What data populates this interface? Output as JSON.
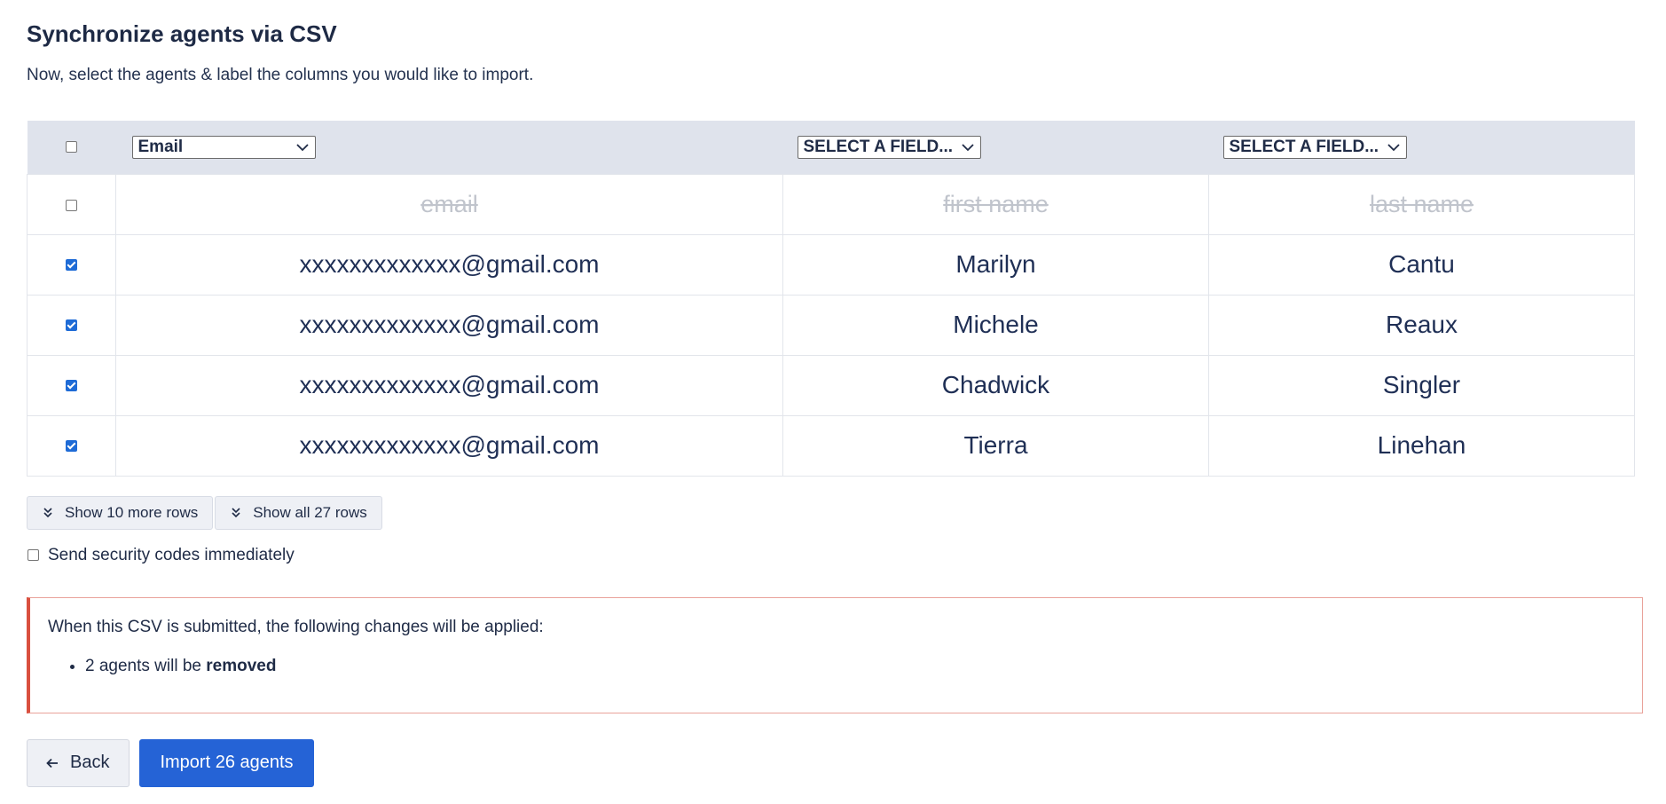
{
  "page": {
    "title": "Synchronize agents via CSV",
    "subtitle": "Now, select the agents & label the columns you would like to import."
  },
  "table": {
    "select_all_checked": false,
    "column_selects": [
      {
        "value": "Email",
        "icon": "chevron-down-icon"
      },
      {
        "value": "SELECT A FIELD...",
        "icon": "chevron-down-icon"
      },
      {
        "value": "SELECT A FIELD...",
        "icon": "chevron-down-icon"
      }
    ],
    "header_row": {
      "checked": false,
      "cells": [
        "email",
        "first name",
        "last name"
      ]
    },
    "rows": [
      {
        "checked": true,
        "cells": [
          "xxxxxxxxxxxxx@gmail.com",
          "Marilyn",
          "Cantu"
        ]
      },
      {
        "checked": true,
        "cells": [
          "xxxxxxxxxxxxx@gmail.com",
          "Michele",
          "Reaux"
        ]
      },
      {
        "checked": true,
        "cells": [
          "xxxxxxxxxxxxx@gmail.com",
          "Chadwick",
          "Singler"
        ]
      },
      {
        "checked": true,
        "cells": [
          "xxxxxxxxxxxxx@gmail.com",
          "Tierra",
          "Linehan"
        ]
      }
    ]
  },
  "pagination": {
    "show_more_label": "Show 10 more rows",
    "show_all_label": "Show all 27 rows",
    "icon": "double-chevron-down-icon"
  },
  "security": {
    "label": "Send security codes immediately",
    "checked": false
  },
  "notice": {
    "intro": "When this CSV is submitted, the following changes will be applied:",
    "item_prefix": "2 agents will be ",
    "item_bold": "removed",
    "accent_color": "#d9503f"
  },
  "actions": {
    "back_label": "Back",
    "back_icon": "arrow-left-icon",
    "import_label": "Import 26 agents",
    "import_color": "#2563d6"
  }
}
